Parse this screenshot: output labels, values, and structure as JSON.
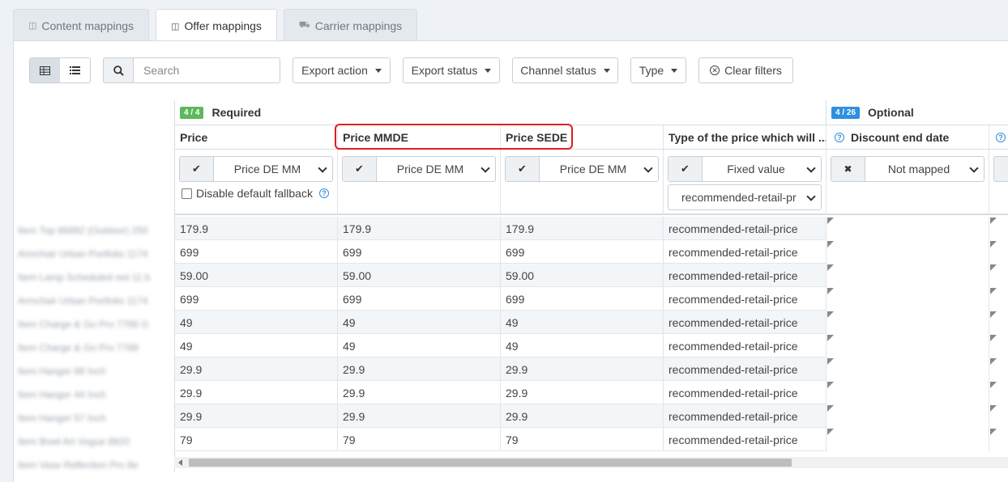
{
  "tabs": [
    {
      "label": "Content mappings",
      "icon": "content-mappings-icon",
      "active": false
    },
    {
      "label": "Offer mappings",
      "icon": "offer-mappings-icon",
      "active": true
    },
    {
      "label": "Carrier mappings",
      "icon": "truck-icon",
      "active": false
    }
  ],
  "toolbar": {
    "search_placeholder": "Search",
    "export_action": "Export action",
    "export_status": "Export status",
    "channel_status": "Channel status",
    "type": "Type",
    "clear_filters": "Clear filters"
  },
  "groups": {
    "required": {
      "badge": "4 / 4",
      "label": "Required",
      "color": "#5cb85c"
    },
    "optional": {
      "badge": "4 / 26",
      "label": "Optional",
      "color": "#2f8fe0"
    }
  },
  "columns": [
    {
      "header": "Price",
      "mapping": "Price DE MM",
      "mapped": true
    },
    {
      "header": "Price MMDE",
      "mapping": "Price DE MM",
      "mapped": true
    },
    {
      "header": "Price SEDE",
      "mapping": "Price DE MM",
      "mapped": true
    },
    {
      "header": "Type of the price which will ...",
      "mapping": "Fixed value",
      "mapped": true,
      "secondary": "recommended-retail-pr"
    },
    {
      "header": "Discount end date",
      "mapping": "Not mapped",
      "mapped": false
    }
  ],
  "fallback_label": "Disable default fallback",
  "rows": [
    {
      "price": "179.9",
      "mmde": "179.9",
      "sede": "179.9",
      "type": "recommended-retail-price"
    },
    {
      "price": "699",
      "mmde": "699",
      "sede": "699",
      "type": "recommended-retail-price"
    },
    {
      "price": "59.00",
      "mmde": "59.00",
      "sede": "59.00",
      "type": "recommended-retail-price"
    },
    {
      "price": "699",
      "mmde": "699",
      "sede": "699",
      "type": "recommended-retail-price"
    },
    {
      "price": "49",
      "mmde": "49",
      "sede": "49",
      "type": "recommended-retail-price"
    },
    {
      "price": "49",
      "mmde": "49",
      "sede": "49",
      "type": "recommended-retail-price"
    },
    {
      "price": "29.9",
      "mmde": "29.9",
      "sede": "29.9",
      "type": "recommended-retail-price"
    },
    {
      "price": "29.9",
      "mmde": "29.9",
      "sede": "29.9",
      "type": "recommended-retail-price"
    },
    {
      "price": "29.9",
      "mmde": "29.9",
      "sede": "29.9",
      "type": "recommended-retail-price"
    },
    {
      "price": "79",
      "mmde": "79",
      "sede": "79",
      "type": "recommended-retail-price"
    }
  ],
  "blurred_names": [
    "Item Top 66892 (Outdoor) 250",
    "Armchair Urban Portfolio 1174",
    "Item Lamp Scheduled red 11 b",
    "Armchair Urban Portfolio 1174",
    "Item Charge & Go Pro 7788 G",
    "Item Charge & Go Pro 7788",
    "Item Hanger 88 Inch",
    "Item Hanger 44 Inch",
    "Item Hanger 57 Inch",
    "Item Bowl Art Vogue 8820",
    "Item Vase Reflection Pro 8e"
  ]
}
